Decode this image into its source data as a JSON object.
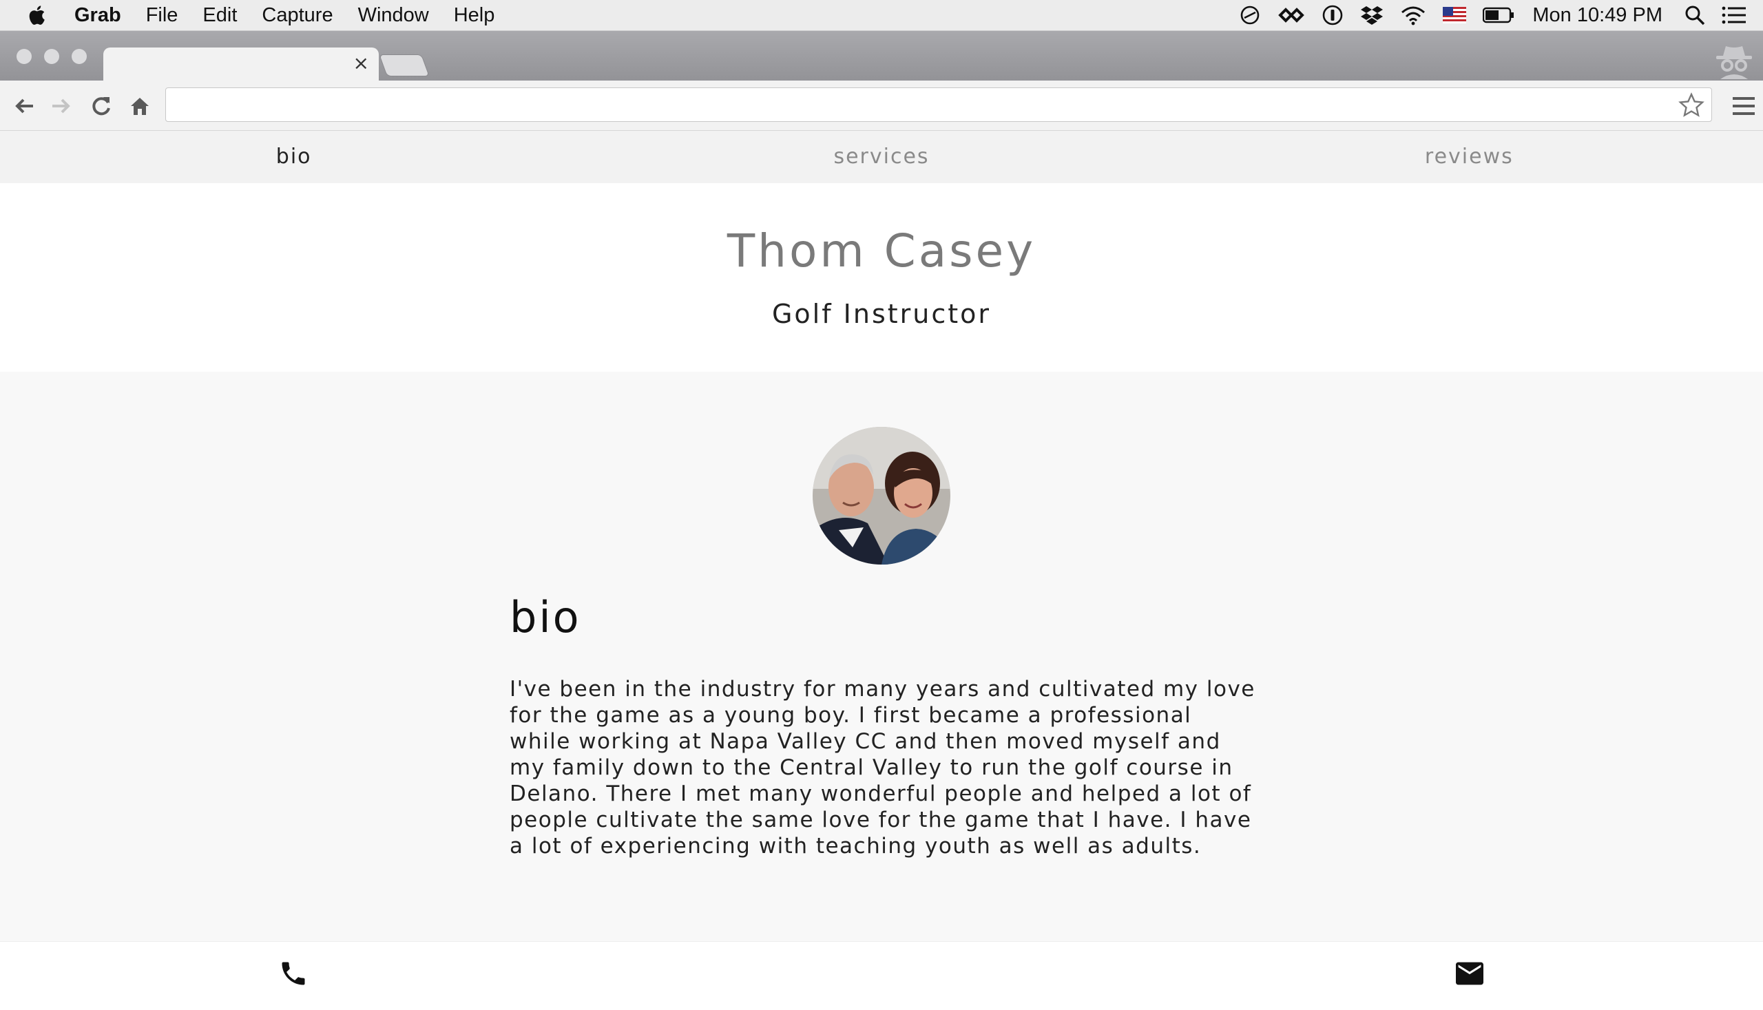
{
  "menubar": {
    "app_name": "Grab",
    "items": [
      "File",
      "Edit",
      "Capture",
      "Window",
      "Help"
    ],
    "clock": "Mon 10:49 PM",
    "status_icons": [
      "creative-cloud-icon",
      "infinity-icon",
      "1password-icon",
      "dropbox-icon",
      "wifi-icon",
      "us-flag-icon",
      "battery-icon",
      "spotlight-icon",
      "notification-list-icon"
    ]
  },
  "browser": {
    "tab_close": "×",
    "address_value": "",
    "address_placeholder": ""
  },
  "nav": {
    "items": [
      {
        "label": "bio",
        "active": true
      },
      {
        "label": "services",
        "active": false
      },
      {
        "label": "reviews",
        "active": false
      }
    ]
  },
  "hero": {
    "name": "Thom Casey",
    "title": "Golf Instructor"
  },
  "bio": {
    "heading": "bio",
    "text": "I've been in the industry for many years and cultivated my love for the game as a young boy. I first became a professional while working at Napa Valley CC and then moved myself and my family down to the Central Valley to run the golf course in Delano. There I met many wonderful people and helped a lot of people cultivate the same love for the game that I have. I have a lot of experiencing with teaching youth as well as adults."
  },
  "footer": {
    "icons": [
      "phone-icon",
      "mail-icon"
    ]
  },
  "colors": {
    "nav_bg": "#f2f2f2",
    "section_bg": "#f8f8f8",
    "name_color": "#7a7a7a",
    "text_color": "#222222"
  }
}
